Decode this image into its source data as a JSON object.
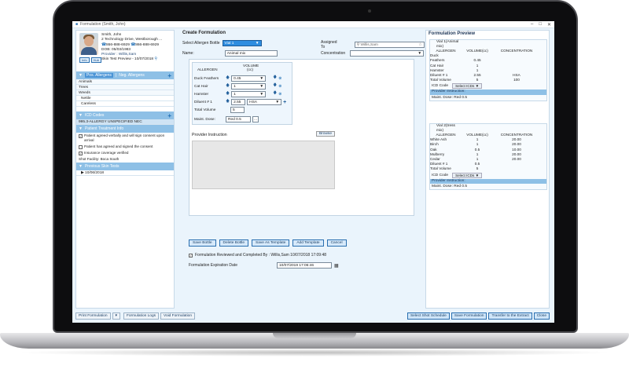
{
  "window": {
    "title": "Formulation (Smith, John)"
  },
  "patient": {
    "name": "Smith, John",
    "address1": "2 Technology Drive, Westborough ...",
    "phone1": "866-888-6929",
    "phone2": "866-888-6929",
    "dob": "DOB: 05/03/1983",
    "provider": "Provider : Willis,Sam",
    "skin_test": "Skin Test Preview - 10/07/2018",
    "btn_info": "Info",
    "btn_hub": "Hub"
  },
  "allergens": {
    "tab_pos": "Pos. Allergens",
    "tab_neg": "Neg. Allergens",
    "items": [
      "Animals",
      "Trees",
      "Weeds"
    ],
    "sub_items": [
      "Nettle",
      "Careless"
    ]
  },
  "icd": {
    "header": "ICD Codes",
    "code": "995.3-ALLERGY UNSPECIFIED NEC"
  },
  "treatment": {
    "header": "Patient Treatment Info",
    "c1": "Patient agreed verbally and will sign consent upon arrival",
    "c2": "Patient has agreed and signed the consent",
    "c3": "Insurance coverage verified",
    "facility": "Shot Facility: Boca South"
  },
  "previous": {
    "header": "Previous Skin Tests",
    "date": "10/06/2018"
  },
  "create": {
    "heading": "Create Formulation",
    "select_bottle_label": "Select Allergen Bottle",
    "select_bottle_value": "Vial 1",
    "assigned_label": "Assigned To",
    "assigned_value": "Willis,Sam",
    "name_label": "Name:",
    "name_value": "Animal mix",
    "concentration_label": "Concentration",
    "col_allergen": "ALLERGEN",
    "col_volume": "VOLUME",
    "col_volume_unit": "(cc)",
    "rows": [
      {
        "name": "Duck Feathers",
        "value": "0.45"
      },
      {
        "name": "Cat Hair",
        "value": "1"
      },
      {
        "name": "Hamster",
        "value": "1"
      }
    ],
    "diluent_label": "Diluent # 1",
    "diluent_value": "2.55",
    "diluent_type": "HSA",
    "total_label": "Total Volume",
    "total_value": "5",
    "maint_label": "Maint. Dose:",
    "maint_value": "Red 0.5",
    "more": "...",
    "provider_instruction": "Provider Instruction",
    "browse": "Browse"
  },
  "actions": {
    "save_bottle": "Save Bottle",
    "delete_bottle": "Delete Bottle",
    "save_template": "Save As Template",
    "add_template": "Add Template",
    "cancel": "Cancel"
  },
  "review": {
    "text": "Formulation Reviewed and Completed By : Willis,Sam 10/07/2018 17:09:48",
    "expiration_label": "Formulation Expiration Date",
    "expiration_value": "10/07/2019 17:06:46"
  },
  "preview": {
    "heading": "Formulation Preview",
    "vial1": {
      "title1": "Vial 1(Animal",
      "title2": "mix)",
      "rows": [
        [
          "ALLERGEN",
          "VOLUME(cc)",
          "CONCENTRATION"
        ],
        [
          "Duck",
          "",
          ""
        ],
        [
          "Feathers",
          "0.45",
          ""
        ],
        [
          "Cat Hair",
          "1",
          ""
        ],
        [
          "Hamster",
          "1",
          ""
        ],
        [
          "Diluent # 1",
          "2.55",
          "HSA"
        ],
        [
          "Total Volume",
          "5",
          "100"
        ]
      ],
      "icd_label": "ICD Code",
      "icd_select": "Select ICDs",
      "pi_label": "Provider Instruction:",
      "maint": "Maint. Dose: Red 0.5"
    },
    "vial2": {
      "title1": "Vial 2(tress",
      "title2": "mix)",
      "rows": [
        [
          "ALLERGEN",
          "VOLUME(cc)",
          "CONCENTRATION"
        ],
        [
          "White Ash",
          "1",
          "20.00"
        ],
        [
          "Birch",
          "1",
          "20.00"
        ],
        [
          "Oak",
          "0.5",
          "10.00"
        ],
        [
          "Mulberry",
          "1",
          "20.00"
        ],
        [
          "Cedar",
          "1",
          "20.00"
        ],
        [
          "Diluent # 1",
          "0.5",
          ""
        ],
        [
          "Total Volume",
          "5",
          ""
        ]
      ],
      "icd_label": "ICD Code",
      "icd_select": "Select ICDs",
      "pi_label": "Provider Instruction:",
      "maint": "Maint. Dose: Red 0.5"
    }
  },
  "bottom": {
    "print": "Print Formulation",
    "logs": "Formulation Logs",
    "void": "Void Formulation",
    "shot_schedule": "Select Shot Schedule",
    "save": "Save Formulation",
    "transfer": "Transfer to the Extract",
    "close": "Close"
  }
}
